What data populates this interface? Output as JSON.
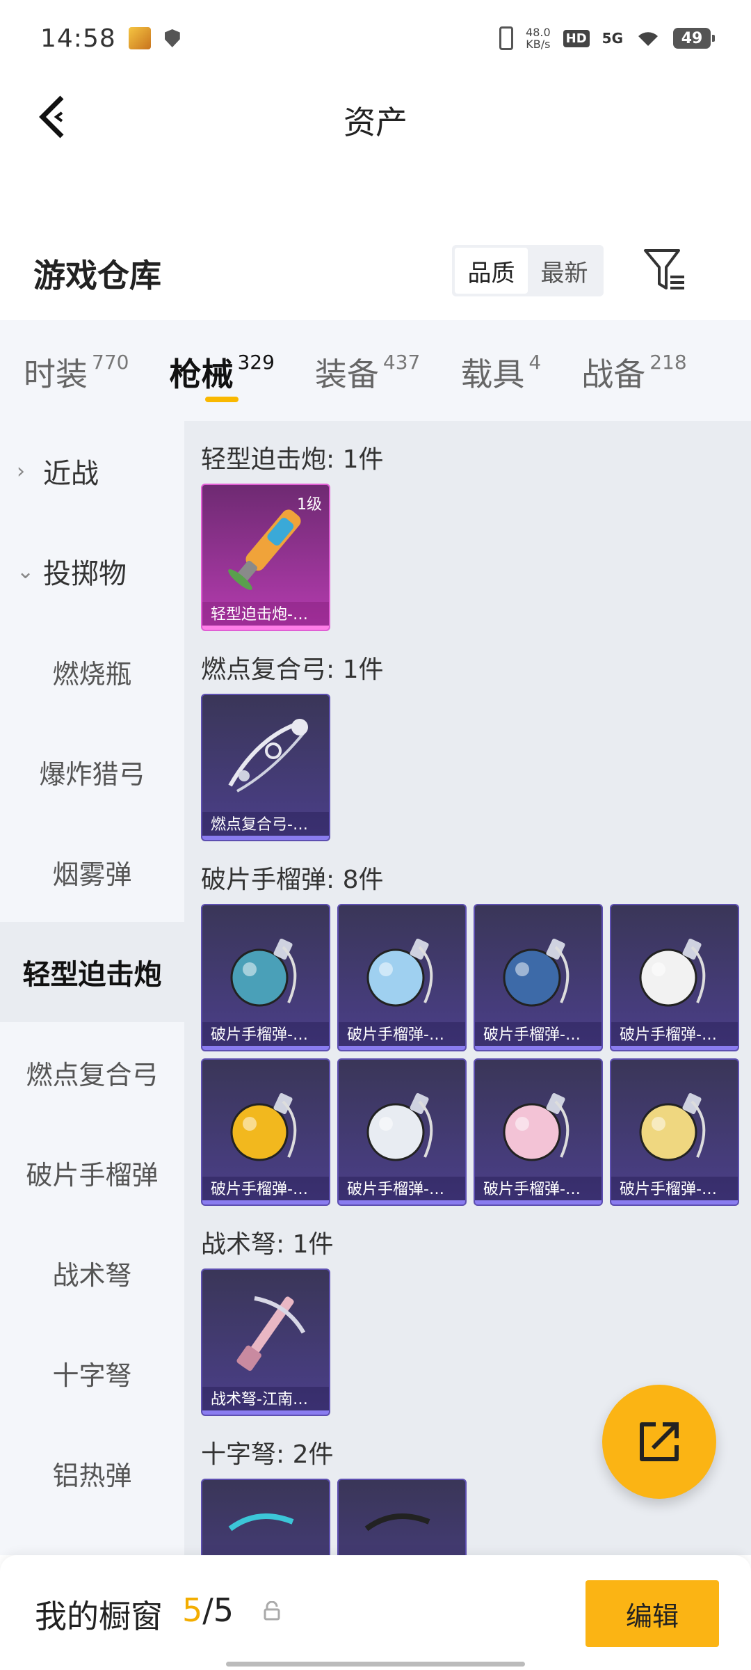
{
  "status": {
    "time": "14:58",
    "speed_value": "48.0",
    "speed_unit": "KB/s",
    "hd": "HD",
    "network": "5G",
    "battery": "49"
  },
  "header": {
    "title": "资产"
  },
  "warehouse": {
    "title": "游戏仓库",
    "sort_options": [
      "品质",
      "最新"
    ],
    "active_sort": "品质"
  },
  "categories": [
    {
      "name": "时装",
      "count": "770"
    },
    {
      "name": "枪械",
      "count": "329",
      "active": true
    },
    {
      "name": "装备",
      "count": "437"
    },
    {
      "name": "载具",
      "count": "4"
    },
    {
      "name": "战备",
      "count": "218"
    }
  ],
  "sidebar": {
    "groups": [
      {
        "label": "近战",
        "expanded": false
      },
      {
        "label": "投掷物",
        "expanded": true
      }
    ],
    "items": [
      "燃烧瓶",
      "爆炸猎弓",
      "烟雾弹",
      "轻型迫击炮",
      "燃点复合弓",
      "破片手榴弹",
      "战术弩",
      "十字弩",
      "铝热弹"
    ],
    "active_item": "轻型迫击炮"
  },
  "sections": [
    {
      "title": "轻型迫击炮: 1件",
      "cards": [
        {
          "label": "轻型迫击炮-…",
          "level": "1级",
          "rarity": "pink",
          "icon": "mortar-icon"
        }
      ]
    },
    {
      "title": "燃点复合弓: 1件",
      "cards": [
        {
          "label": "燃点复合弓-…",
          "rarity": "purple",
          "icon": "bow-icon"
        }
      ]
    },
    {
      "title": "破片手榴弹: 8件",
      "cards": [
        {
          "label": "破片手榴弹-…",
          "rarity": "purple",
          "icon": "grenade-icon",
          "color": "#4aa0b8"
        },
        {
          "label": "破片手榴弹-…",
          "rarity": "purple",
          "icon": "grenade-icon",
          "color": "#9fd0f0"
        },
        {
          "label": "破片手榴弹-…",
          "rarity": "purple",
          "icon": "grenade-icon",
          "color": "#3d6aa8"
        },
        {
          "label": "破片手榴弹-…",
          "rarity": "purple",
          "icon": "grenade-icon",
          "color": "#f2f2f2"
        },
        {
          "label": "破片手榴弹-…",
          "rarity": "purple",
          "icon": "grenade-icon",
          "color": "#f2b81e"
        },
        {
          "label": "破片手榴弹-…",
          "rarity": "purple",
          "icon": "grenade-icon",
          "color": "#e8ecf2"
        },
        {
          "label": "破片手榴弹-…",
          "rarity": "purple",
          "icon": "grenade-icon",
          "color": "#f3c3d6"
        },
        {
          "label": "破片手榴弹-…",
          "rarity": "purple",
          "icon": "grenade-icon",
          "color": "#efd780"
        }
      ]
    },
    {
      "title": "战术弩: 1件",
      "cards": [
        {
          "label": "战术弩-江南…",
          "rarity": "purple",
          "icon": "crossbow-icon"
        }
      ]
    },
    {
      "title": "十字弩: 2件",
      "cards": [
        {
          "label": "",
          "rarity": "purple",
          "icon": "crossbow-icon"
        },
        {
          "label": "",
          "rarity": "purple",
          "icon": "crossbow-icon"
        }
      ]
    }
  ],
  "showcase": {
    "label": "我的橱窗",
    "current": "5",
    "separator": "/",
    "total": "5",
    "edit_label": "编辑"
  },
  "colors": {
    "accent": "#fbb414",
    "pink_card": "#b63cb0",
    "purple_card": "#4b3f8a"
  }
}
